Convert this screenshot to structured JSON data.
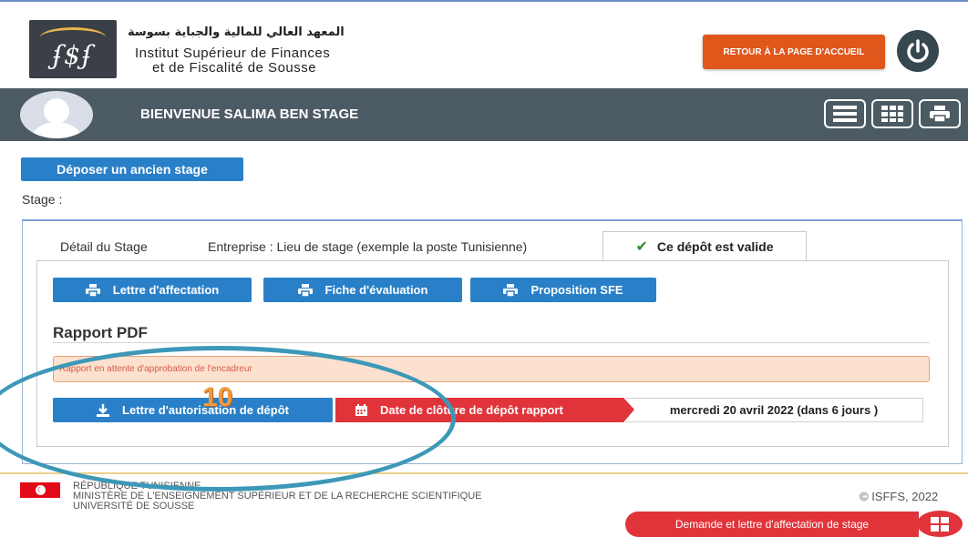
{
  "header": {
    "logo_text": "ʄ$ʄ",
    "institute_ar": "المعهد العالي للمالية والجباية بسوسة",
    "institute_fr_line1": "Institut Supérieur de Finances",
    "institute_fr_line2": "et de Fiscalité de Sousse",
    "retour_button": "RETOUR À LA PAGE D'ACCUEIL",
    "power_icon": "power-icon"
  },
  "welcome": {
    "text": "BIENVENUE SALIMA BEN STAGE",
    "tools": [
      "list-icon",
      "grid-icon",
      "print-icon"
    ]
  },
  "main": {
    "deposer_button": "Déposer un ancien stage",
    "stage_label": "Stage :",
    "tabs": [
      {
        "label": "Détail du Stage"
      },
      {
        "label": "Entreprise : Lieu de stage (exemple la poste Tunisienne)"
      },
      {
        "label": "Ce dépôt est valide",
        "active": true
      }
    ],
    "buttons": [
      {
        "label": "Lettre d'affectation",
        "icon": "print-icon"
      },
      {
        "label": "Fiche d'évaluation",
        "icon": "print-icon"
      },
      {
        "label": "Proposition SFE",
        "icon": "print-icon"
      }
    ],
    "rapport_title": "Rapport PDF",
    "alert_text": "Rapport en attente d'approbation de l'encadreur",
    "autorisation_button": "Lettre d'autorisation de dépôt",
    "cloture_label": "Date de clôture de dépôt rapport",
    "cloture_date": "mercredi 20 avril 2022 (dans 6 jours )"
  },
  "footer": {
    "line1": "RÉPUBLIQUE TUNISIENNE",
    "line2": "MINISTÈRE DE L'ENSEIGNEMENT SUPÉRIEUR ET DE LA RECHERCHE SCIENTIFIQUE",
    "line3": "UNIVERSITÉ DE SOUSSE",
    "copyright": "© ISFFS, 2022",
    "demande_button": "Demande et lettre d'affectation de stage"
  },
  "annotation": {
    "number": "10"
  },
  "colors": {
    "primary_blue": "#2a80c8",
    "danger_red": "#e0343a",
    "header_dark": "#4c5a63",
    "retour_orange": "#e0571c",
    "annotation_teal": "#3d98b8",
    "annotation_orange": "#f19a3e"
  }
}
